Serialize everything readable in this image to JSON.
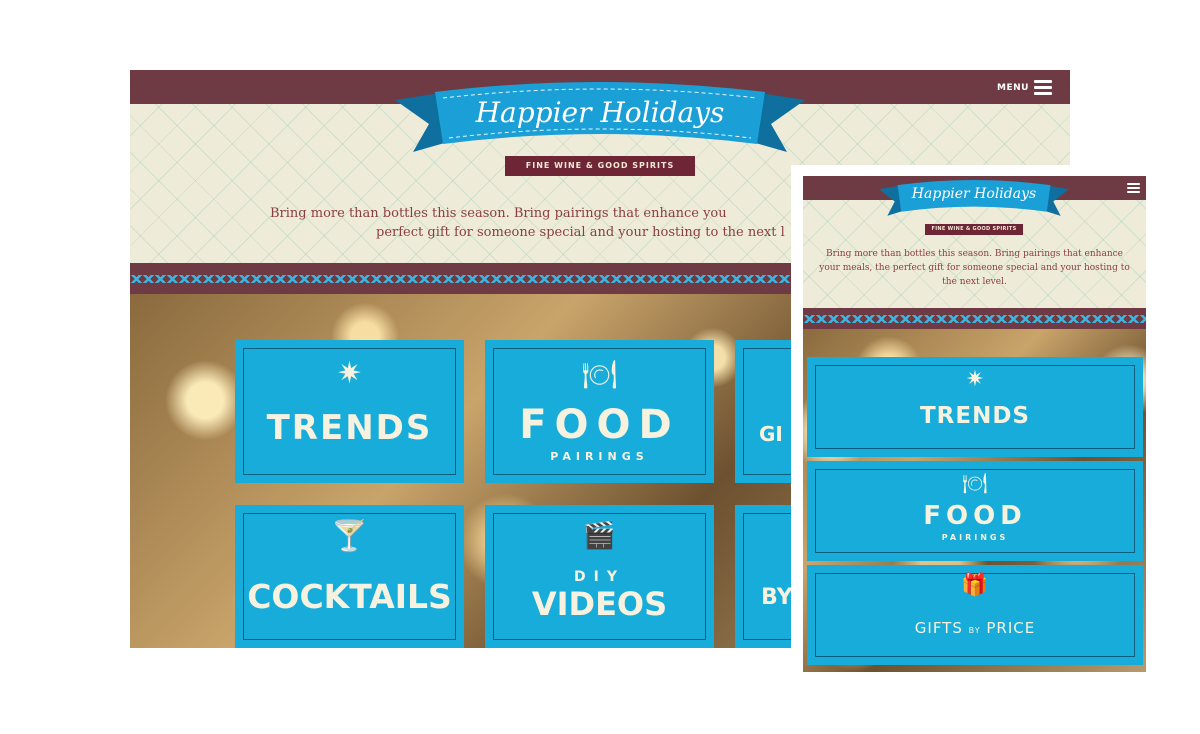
{
  "desktop": {
    "header": {
      "menu_label": "MENU"
    },
    "logo": {
      "title": "Happier Holidays",
      "tagline": "FINE WINE & GOOD SPIRITS"
    },
    "intro_line1": "Bring more than bottles this season. Bring pairings that enhance you",
    "intro_line2": "perfect gift for someone special and your hosting to the next l",
    "tiles": {
      "trends": "TRENDS",
      "food_main": "FOOD",
      "food_sub": "PAIRINGS",
      "gifts_partial": "GI",
      "cocktails": "COCKTAILS",
      "diy": "DIY",
      "videos": "VIDEOS",
      "by_partial": "BY"
    }
  },
  "mobile": {
    "logo": {
      "title": "Happier Holidays",
      "tagline": "FINE WINE & GOOD SPIRITS"
    },
    "intro": "Bring more than bottles this season. Bring pairings that enhance your meals, the perfect gift for someone special and your hosting to the next level.",
    "tiles": {
      "trends": "TRENDS",
      "food_main": "FOOD",
      "food_sub": "PAIRINGS",
      "gifts_left": "GIFTS",
      "gifts_mid": "BY",
      "gifts_right": "PRICE"
    }
  },
  "icons": {
    "sparkle": "sparkle-icon",
    "plate": "plate-icon",
    "cocktail": "cocktail-glass-icon",
    "clapper": "clapperboard-icon",
    "gift": "gift-icon",
    "menu": "hamburger-menu-icon"
  },
  "colors": {
    "brand_maroon": "#6e3b45",
    "tile_blue": "#17acd9",
    "cream": "#eeecd9",
    "intro_text": "#8a3e40"
  }
}
